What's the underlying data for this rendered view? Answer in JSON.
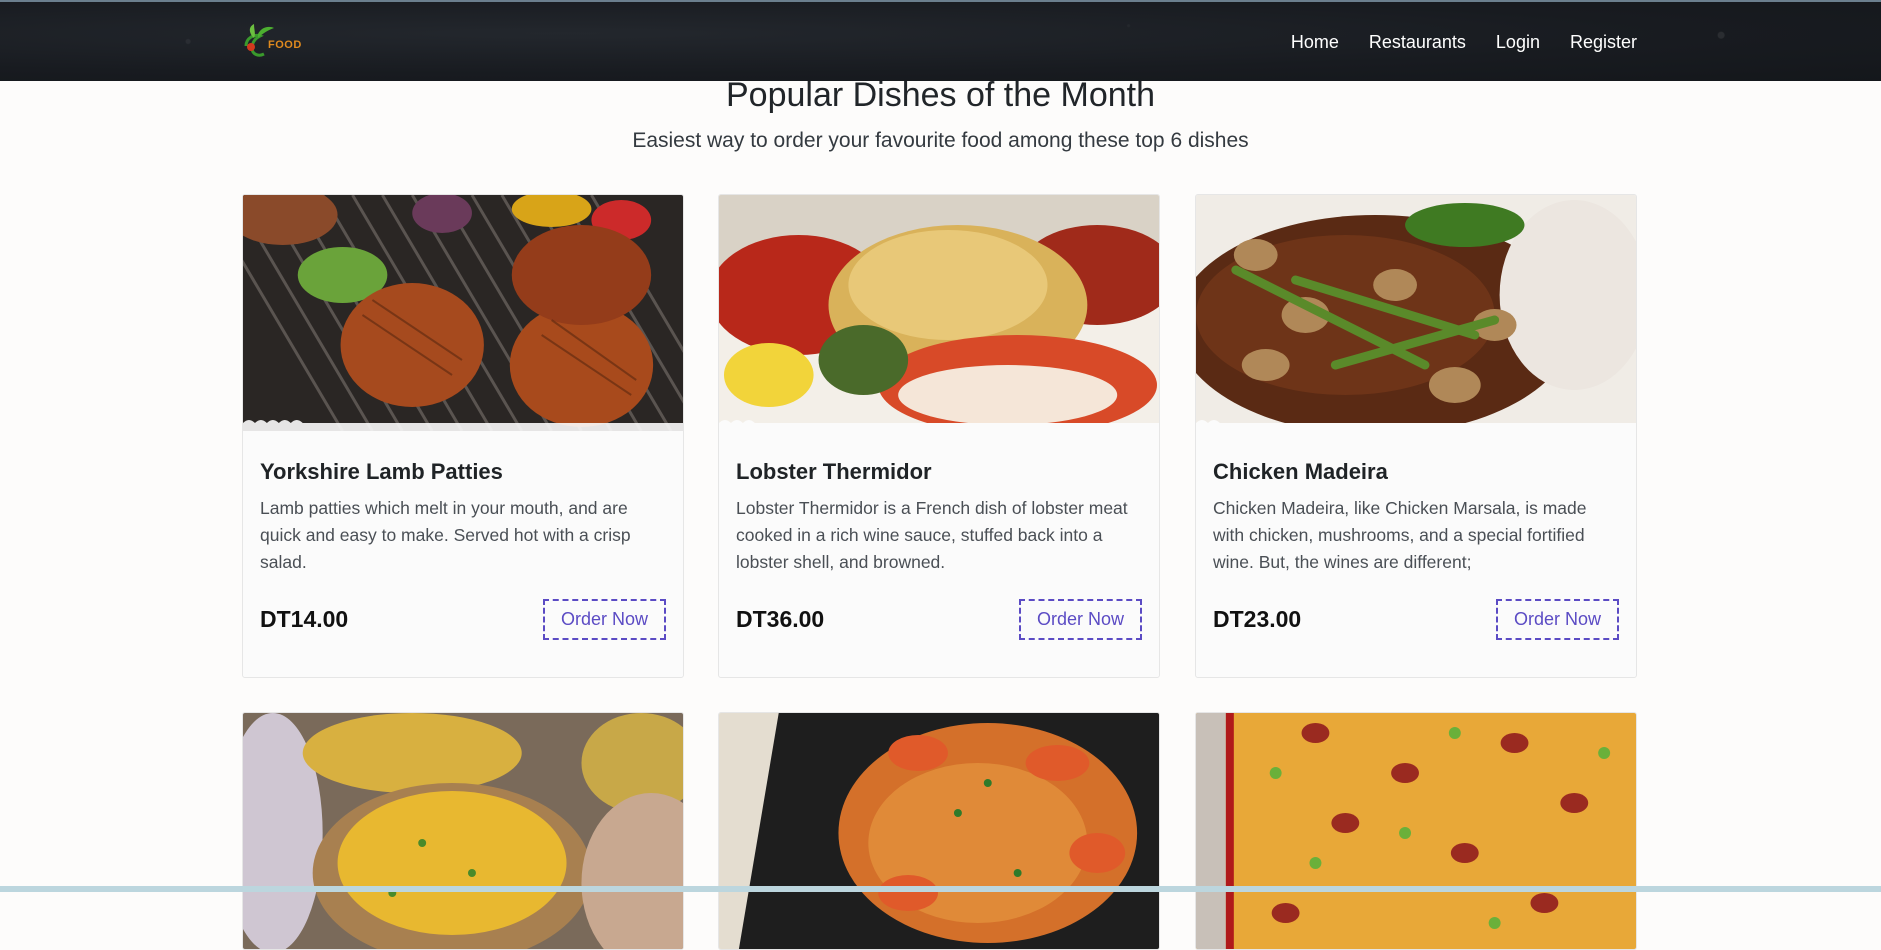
{
  "navbar": {
    "logo_text": "FOOD",
    "links": [
      "Home",
      "Restaurants",
      "Login",
      "Register"
    ]
  },
  "section": {
    "title": "Popular Dishes of the Month",
    "subtitle": "Easiest way to order your favourite food among these top 6 dishes"
  },
  "dishes": [
    {
      "name": "Yorkshire Lamb Patties",
      "description": "Lamb patties which melt in your mouth, and are quick and easy to make. Served hot with a crisp salad.",
      "price": "DT14.00",
      "button": "Order Now",
      "image": "grilled-lamb-patties"
    },
    {
      "name": "Lobster Thermidor",
      "description": "Lobster Thermidor is a French dish of lobster meat cooked in a rich wine sauce, stuffed back into a lobster shell, and browned.",
      "price": "DT36.00",
      "button": "Order Now",
      "image": "lobster-thermidor"
    },
    {
      "name": "Chicken Madeira",
      "description": "Chicken Madeira, like Chicken Marsala, is made with chicken, mushrooms, and a special fortified wine. But, the wines are different;",
      "price": "DT23.00",
      "button": "Order Now",
      "image": "chicken-madeira"
    },
    {
      "image": "stuffed-potato-skins"
    },
    {
      "image": "shrimp-spaghetti"
    },
    {
      "image": "cheesy-casserole"
    }
  ],
  "colors": {
    "navbar_bg": "#181b20",
    "accent": "#5b4bc4",
    "logo_orange": "#e08a1e"
  }
}
